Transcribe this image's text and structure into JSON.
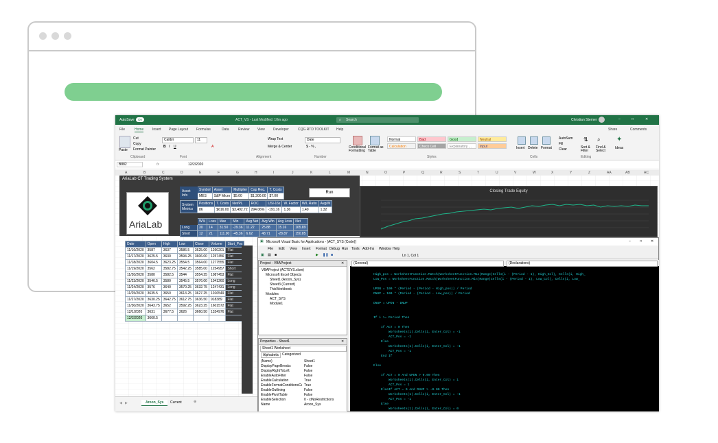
{
  "excel": {
    "window_title": "ACT_VS - Last Modified: 10m ago",
    "search_placeholder": "Search",
    "user": "Christian Sterner",
    "autosave": "AutoSave",
    "autosave_state": "On",
    "menu": [
      "File",
      "Home",
      "Insert",
      "Page Layout",
      "Formulas",
      "Data",
      "Review",
      "View",
      "Developer",
      "CQG RTD TOOLKIT",
      "Help"
    ],
    "share": "Share",
    "comments": "Comments",
    "ribbon": {
      "paste": "Paste",
      "cut": "Cut",
      "copy": "Copy",
      "format_painter": "Format Painter",
      "clipboard": "Clipboard",
      "font_name": "Calibri",
      "font_size": "11",
      "font": "Font",
      "wrap_text": "Wrap Text",
      "merge_center": "Merge & Center",
      "alignment": "Alignment",
      "number_format": "Date",
      "number": "Number",
      "conditional": "Conditional Formatting",
      "format_table": "Format as Table",
      "styles_label": "Styles",
      "styles": [
        {
          "label": "Normal",
          "bg": "#ffffff",
          "color": "#000000"
        },
        {
          "label": "Bad",
          "bg": "#ffc7ce",
          "color": "#9c0006"
        },
        {
          "label": "Good",
          "bg": "#c6efce",
          "color": "#006100"
        },
        {
          "label": "Neutral",
          "bg": "#ffeb9c",
          "color": "#9c5700"
        },
        {
          "label": "Calculation",
          "bg": "#f2f2f2",
          "color": "#fa7d00"
        },
        {
          "label": "Check Cell",
          "bg": "#a5a5a5",
          "color": "#ffffff"
        },
        {
          "label": "Explanatory ...",
          "bg": "#ffffff",
          "color": "#7f7f7f"
        },
        {
          "label": "Input",
          "bg": "#ffcc99",
          "color": "#3f3f76"
        }
      ],
      "insert": "Insert",
      "delete": "Delete",
      "format": "Format",
      "cells": "Cells",
      "autosum": "AutoSum",
      "fill": "Fill",
      "clear": "Clear",
      "sort_filter": "Sort & Filter",
      "find_select": "Find & Select",
      "editing": "Editing",
      "ideas": "Ideas"
    },
    "name_box": "B882",
    "formula": "12/2/2020",
    "columns": [
      "A",
      "B",
      "C",
      "D",
      "E",
      "F",
      "G",
      "H",
      "I",
      "J",
      "K",
      "L",
      "M",
      "N",
      "O",
      "P",
      "Q",
      "R",
      "S",
      "T",
      "U",
      "V",
      "W",
      "X",
      "Y",
      "Z",
      "AA",
      "AB",
      "AC"
    ],
    "dashboard": {
      "title": "AriaLab CT Trading System",
      "logo_text": "AriaLab",
      "asset_info_label": "Asset Info",
      "asset_headers": [
        "Symbol",
        "Asset",
        "Multiplier",
        "Cap Req.",
        "T. Costs"
      ],
      "asset_values": [
        "MES",
        "S&P Micro",
        "$5.00",
        "$1,300.00",
        "$7.00"
      ],
      "run_button": "Run",
      "sys_metrics_label": "System Metrics",
      "metric_headers": [
        "Positions",
        "T. Costs",
        "Net/PL",
        "ROC",
        "USI-16x",
        "W. Factor",
        "W/L Ratio",
        "Avg/W"
      ],
      "metric_values": [
        "86",
        "$616.00",
        "$3,492.72",
        "294.06%",
        "-191.16",
        "1.36",
        "1.40",
        "1.32"
      ],
      "trade_headers": [
        "W%",
        "Loss",
        "Max",
        "Min",
        "Avg Net",
        "Avg Win",
        "Avg Loss",
        "Net"
      ],
      "long_label": "Long",
      "long_values": [
        "30",
        "14",
        "31.50",
        "-29.36",
        "11.22",
        "25.88",
        "15.16",
        "165.89"
      ],
      "short_label": "Short",
      "short_values": [
        "12",
        "21",
        "111.90",
        "-45.36",
        "6.62",
        "48.71",
        "-28.87",
        "150.85"
      ]
    },
    "chart_title": "Closing Trade Equity",
    "data_headers": [
      "Date",
      "Open",
      "High",
      "Low",
      "Close",
      "Volume",
      "Start_Pos"
    ],
    "rows": [
      [
        "11/16/2020",
        "3587",
        "3637",
        "3586.5",
        "3625.00",
        "1260201",
        "Flat"
      ],
      [
        "11/17/2020",
        "3625.5",
        "3630",
        "3594.25",
        "3606.00",
        "1257456",
        "Flat"
      ],
      [
        "11/18/2020",
        "3604.5",
        "3623.25",
        "3554.5",
        "3564.00",
        "1277555",
        "Flat"
      ],
      [
        "11/19/2020",
        "3562",
        "3582.75",
        "3542.25",
        "3585.00",
        "1254957",
        "Short"
      ],
      [
        "11/20/2020",
        "3580",
        "3582.5",
        "3544",
        "3554.25",
        "1087453",
        "Flat"
      ],
      [
        "11/23/2020",
        "3546.5",
        "3580",
        "3545.5",
        "3576.00",
        "1041260",
        "Long"
      ],
      [
        "11/24/2020",
        "3576",
        "3640",
        "3570.25",
        "3632.75",
        "1247431",
        "Long"
      ],
      [
        "11/25/2020",
        "3635.5",
        "3650",
        "3613.25",
        "3627.25",
        "1016549",
        "Flat"
      ],
      [
        "11/27/2020",
        "3630.25",
        "3642.75",
        "3612.75",
        "3636.50",
        "918389",
        "Flat"
      ],
      [
        "11/30/2020",
        "3643.75",
        "3652",
        "3592.25",
        "3623.25",
        "1601572",
        "Flat"
      ],
      [
        "12/1/2020",
        "3631",
        "3677.5",
        "3626",
        "3660.50",
        "1324976",
        "Flat"
      ],
      [
        "12/2/2020",
        "3660.5",
        "",
        "",
        "",
        "",
        ""
      ]
    ],
    "sheet_tabs": [
      "Aroon_Sys",
      "Current"
    ],
    "active_tab": "Aroon_Sys"
  },
  "vba": {
    "window_title": "Microsoft Visual Basic for Applications - [ACT_SYS (Code)]",
    "menu": [
      "File",
      "Edit",
      "View",
      "Insert",
      "Format",
      "Debug",
      "Run",
      "Tools",
      "Add-Ins",
      "Window",
      "Help"
    ],
    "cursor_pos": "Ln 1, Col 1",
    "project_title": "Project - VBAProject",
    "project_tree": [
      "VBAProject (ACTSYS.xlsm)",
      "Microsoft Excel Objects",
      "Sheet1 (Aroon_Sys)",
      "Sheet3 (Current)",
      "ThisWorkbook",
      "Modules",
      "ACT_SYS",
      "Module1"
    ],
    "props_title": "Properties - Sheet1",
    "props_object": "Sheet1 Worksheet",
    "props_tabs": [
      "Alphabetic",
      "Categorized"
    ],
    "props": [
      [
        "(Name)",
        "Sheet1"
      ],
      [
        "DisplayPageBreaks",
        "False"
      ],
      [
        "DisplayRightToLeft",
        "False"
      ],
      [
        "EnableAutoFilter",
        "False"
      ],
      [
        "EnableCalculation",
        "True"
      ],
      [
        "EnableFormatConditionsCalculation",
        "True"
      ],
      [
        "EnableOutlining",
        "False"
      ],
      [
        "EnablePivotTable",
        "False"
      ],
      [
        "EnableSelection",
        "0 - xlNoRestrictions"
      ],
      [
        "Name",
        "Aroon_Sys"
      ]
    ],
    "combo_general": "(General)",
    "combo_decl": "(Declarations)",
    "code_lines": [
      "High_pos = WorksheetFunction.Match(WorksheetFunction.Max(Range(Cells(i - (Period - 1), High_Col), Cells(i, High_",
      "Low_Pos = WorksheetFunction.Match(WorksheetFunction.Min(Range(Cells(i - (Period - 1), Low_Col), Cells(i, Low_",
      "",
      "UPDN = 100 * (Period - (Period - High_pos)) / Period",
      "DNUP = 100 * (Period - (Period - Low_pos)) / Period",
      "",
      "DNUP = UPDN - DNUP",
      "",
      "",
      "If i >= Period Then",
      "",
      "    If ACT = 0 Then",
      "        Worksheets(1).Cells(i, Enter_Col) = -1",
      "        ACT_Pos = -1",
      "    Else",
      "        Worksheets(1).Cells(i, Enter_Col) = -1",
      "        ACT_Pos = -1",
      "    End If",
      "",
      "Else",
      "",
      "    If ACT = 0 And UPDN > 0.00 Then",
      "        Worksheets(1).Cells(i, Enter_Col) = 1",
      "        ACT_Pos = 1",
      "    ElseIf ACT = 0 And DNUP > -0.00 Then",
      "        Worksheets(1).Cells(i, Enter_Col) = -1",
      "        ACT_Pos = -1",
      "    Else",
      "        Worksheets(1).Cells(i, Enter_Col) = 0",
      "        ACT_Pos = 0"
    ]
  }
}
